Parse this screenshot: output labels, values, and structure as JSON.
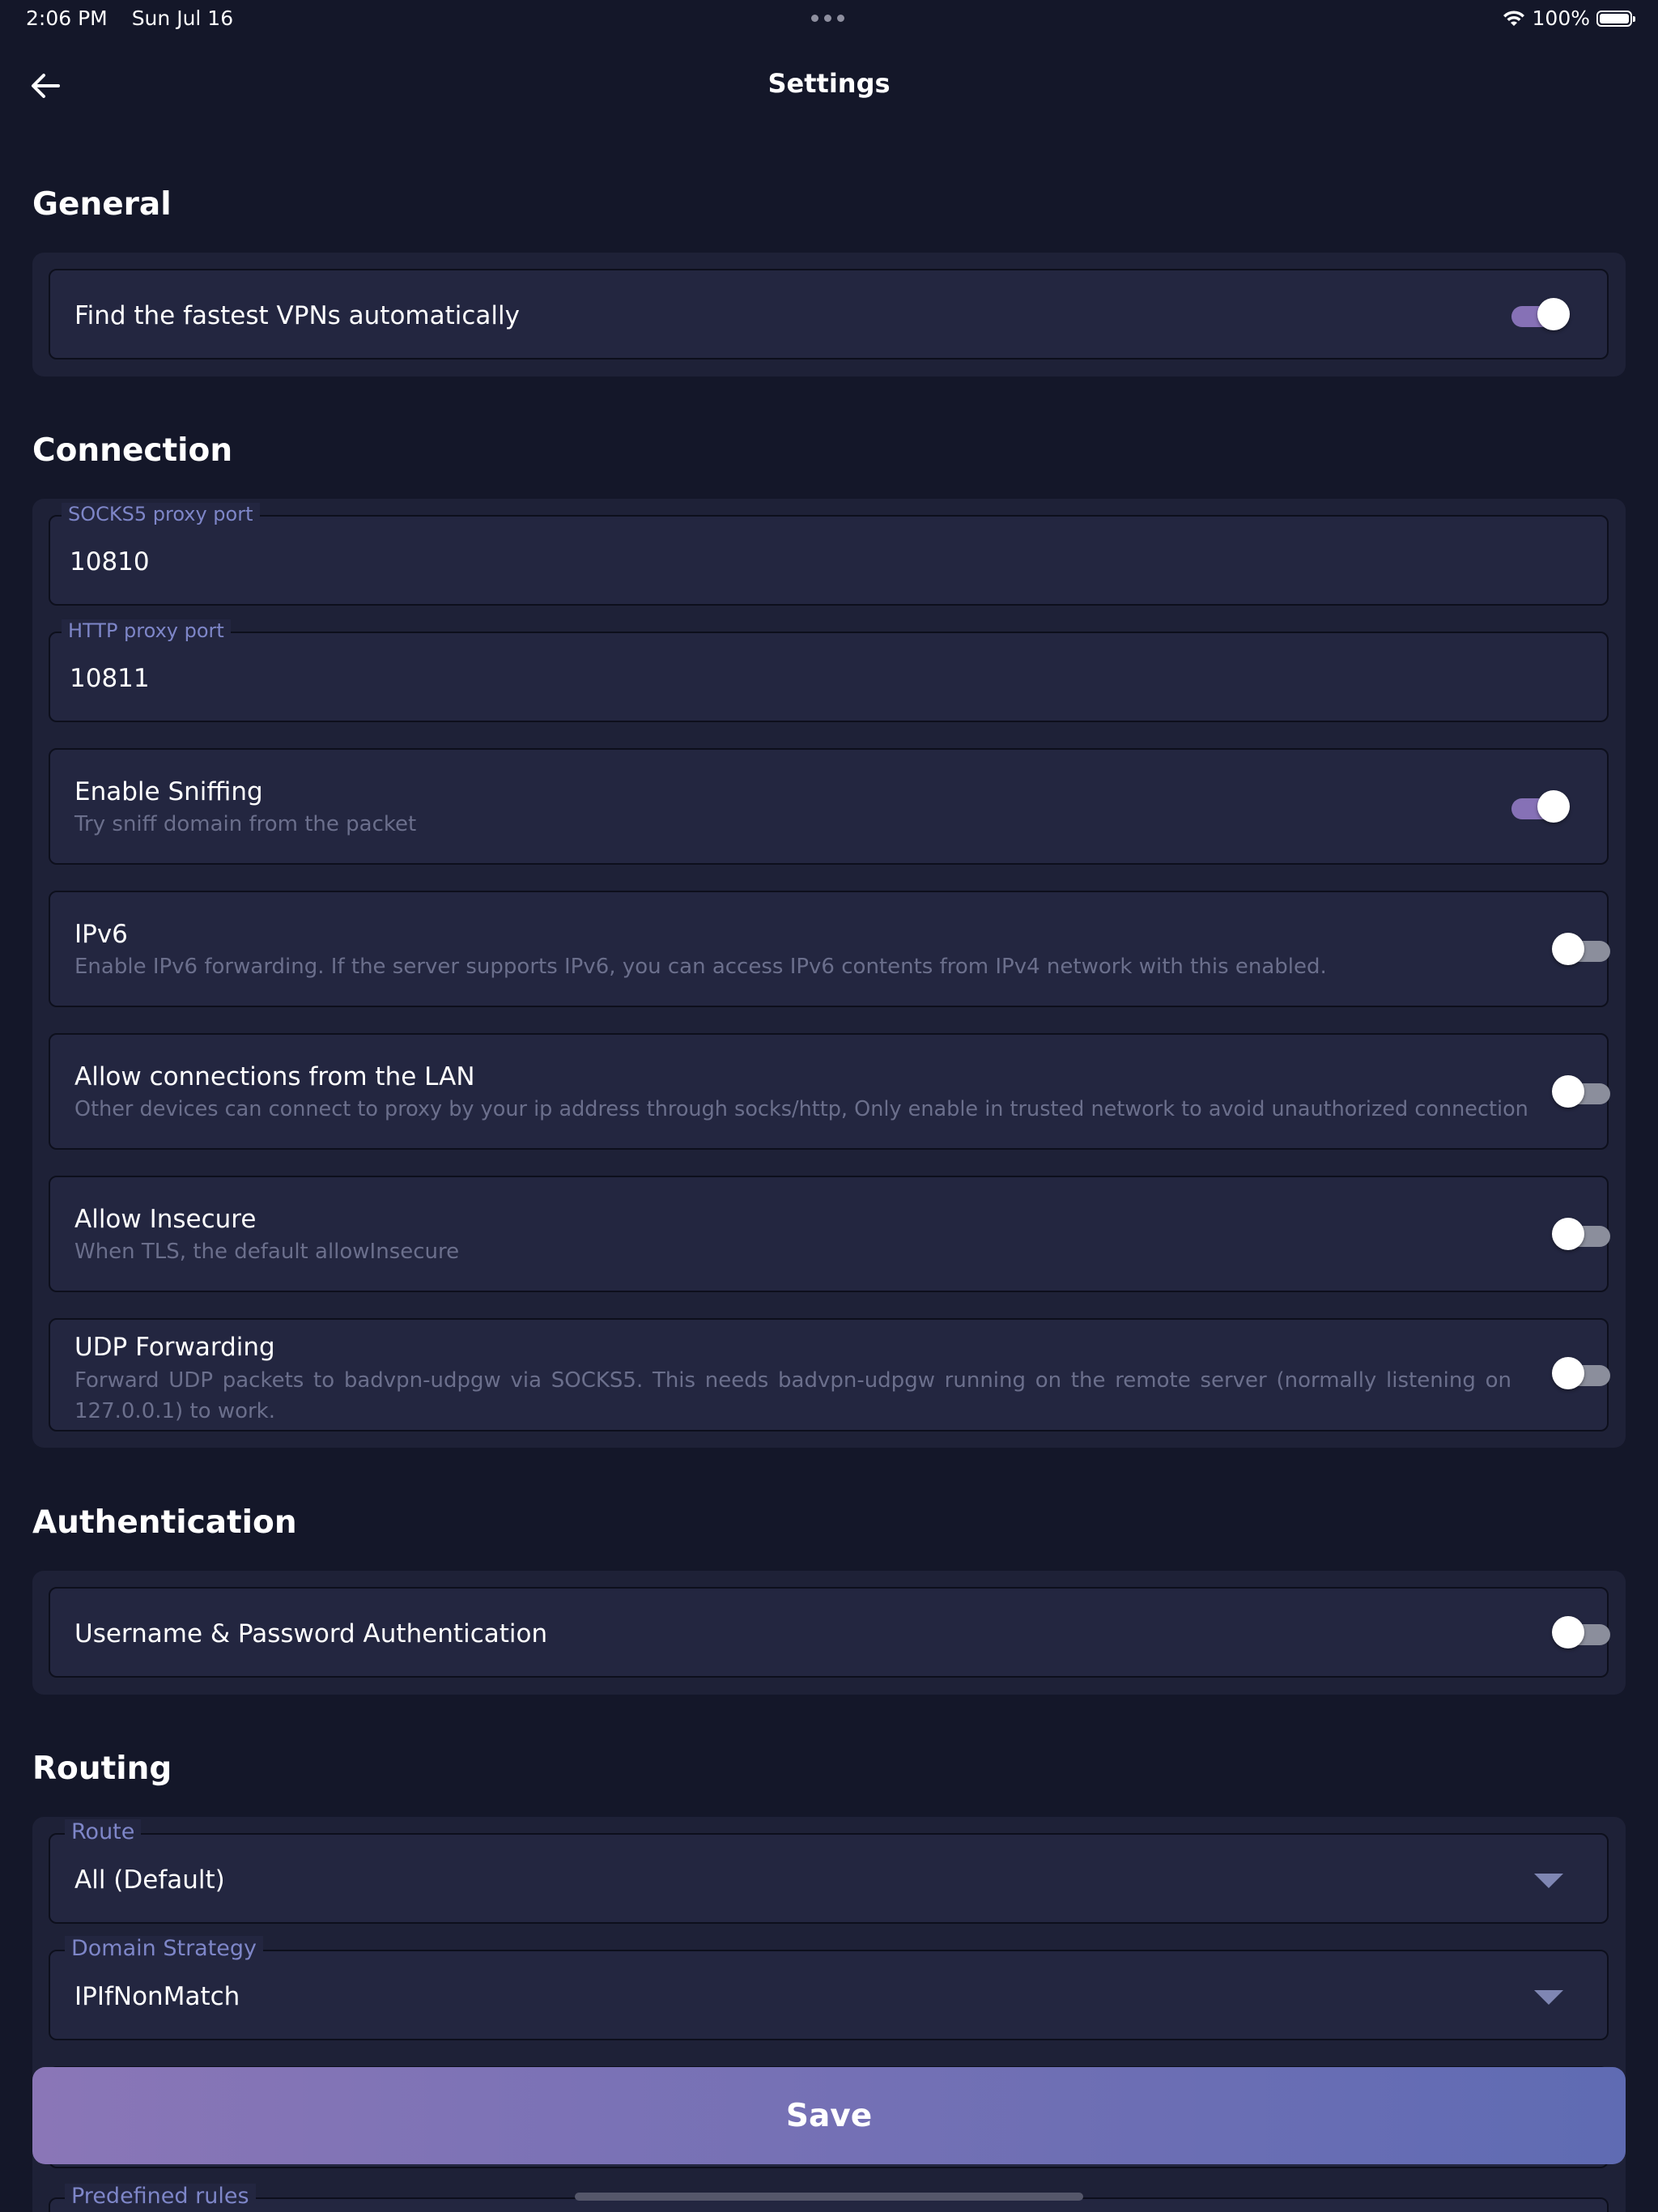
{
  "status_bar": {
    "time": "2:06 PM",
    "date": "Sun Jul 16",
    "battery": "100%",
    "icons": [
      "more-dots-icon",
      "wifi-icon",
      "battery-icon"
    ]
  },
  "header": {
    "title": "Settings",
    "back_icon": "arrow-left-icon"
  },
  "general": {
    "title": "General",
    "fastest_vpn": {
      "label": "Find the fastest VPNs automatically",
      "enabled": true
    }
  },
  "connection": {
    "title": "Connection",
    "socks5": {
      "label": "SOCKS5 proxy port",
      "value": "10810"
    },
    "http": {
      "label": "HTTP proxy port",
      "value": "10811"
    },
    "sniffing": {
      "label": "Enable Sniffing",
      "description": "Try sniff domain from the packet",
      "enabled": true
    },
    "ipv6": {
      "label": "IPv6",
      "description": "Enable IPv6 forwarding. If the server supports IPv6, you can access IPv6 contents from IPv4 network with this enabled.",
      "enabled": false
    },
    "lan": {
      "label": "Allow connections from the LAN",
      "description": "Other devices can connect to proxy by your ip address through socks/http, Only enable in trusted network to avoid unauthorized connection",
      "enabled": false
    },
    "insecure": {
      "label": "Allow Insecure",
      "description": "When TLS, the default allowInsecure",
      "enabled": false
    },
    "udp": {
      "label": "UDP Forwarding",
      "description": "Forward UDP packets to badvpn-udpgw via SOCKS5. This needs badvpn-udpgw running on the remote server (normally listening on 127.0.0.1) to work.",
      "enabled": false
    }
  },
  "authentication": {
    "title": "Authentication",
    "userpass": {
      "label": "Username & Password Authentication",
      "enabled": false
    }
  },
  "routing": {
    "title": "Routing",
    "route": {
      "label": "Route",
      "value": "All (Default)"
    },
    "domain_strategy": {
      "label": "Domain Strategy",
      "value": "IPIfNonMatch"
    },
    "predefined_rules": {
      "label": "Predefined rules"
    }
  },
  "save_label": "Save",
  "colors": {
    "background": "#141729",
    "card": "#1e2137",
    "row": "#232640",
    "toggle_on": "#8671b6",
    "accent_label": "#7e86c8",
    "save_gradient_start": "#8a76b7",
    "save_gradient_end": "#5f6bb3"
  }
}
